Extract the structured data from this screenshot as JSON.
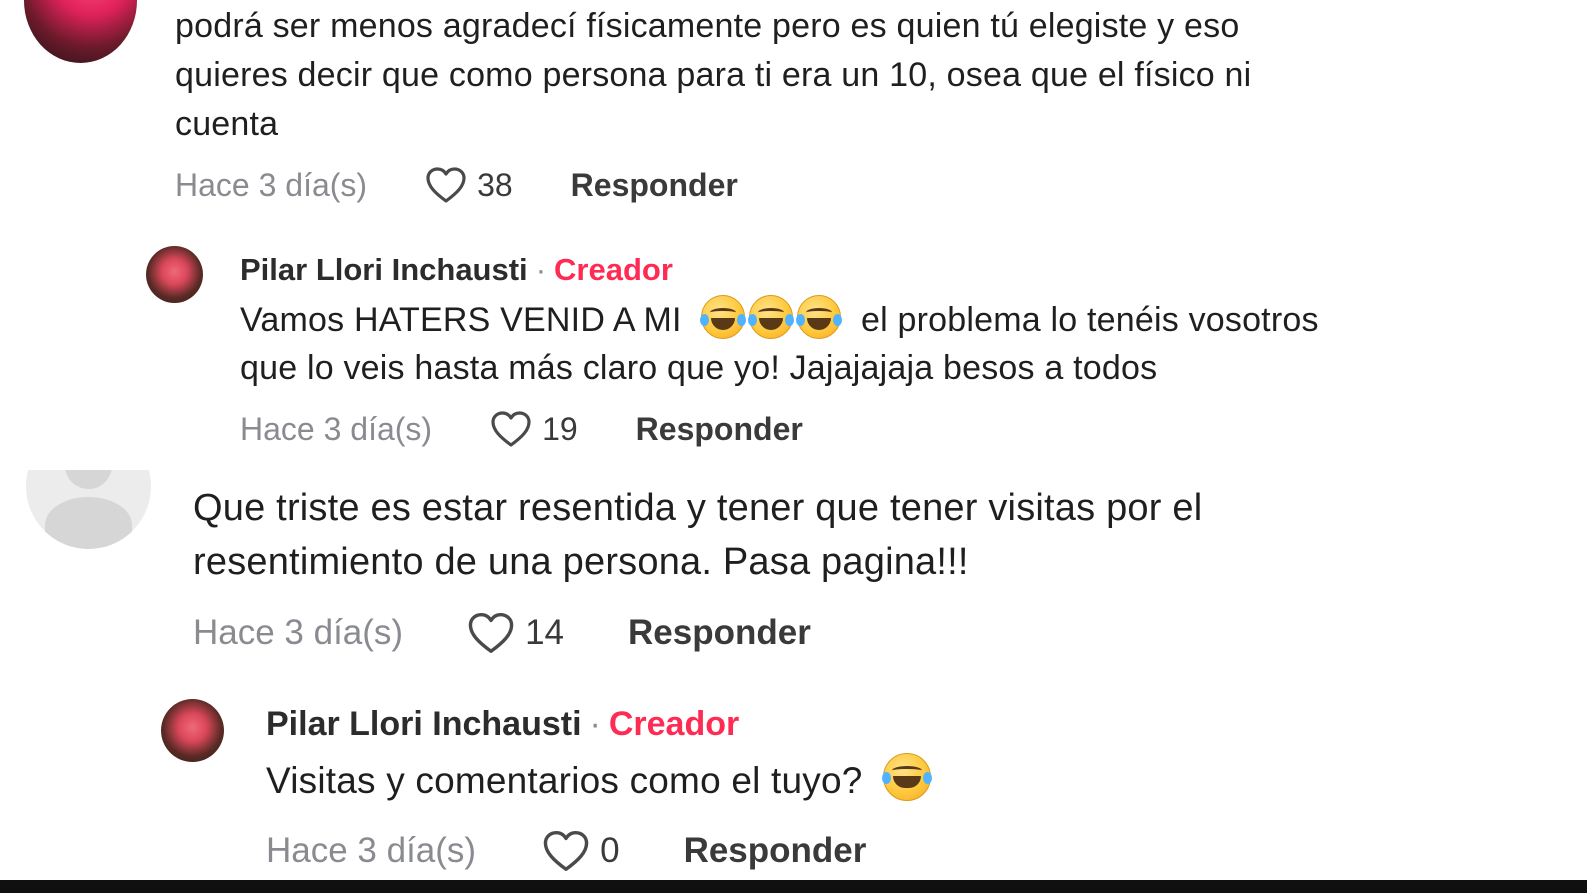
{
  "comments": [
    {
      "text_lines": [
        "podrá ser menos agradecí físicamente pero es quien tú elegiste y eso",
        "quieres decir que como persona para ti era un 10, osea que el físico ni",
        "cuenta"
      ],
      "time": "Hace 3 día(s)",
      "likes": "38",
      "reply_label": "Responder"
    },
    {
      "author": "Pilar Llori Inchausti",
      "separator": "·",
      "badge": "Creador",
      "line1_before": "Vamos HATERS VENID A MI",
      "line1_after": "el problema lo tenéis vosotros",
      "line2": "que lo veis hasta más claro que yo! Jajajajaja besos a todos",
      "emojis": [
        "face-with-tears-of-joy-icon",
        "face-with-tears-of-joy-icon",
        "face-with-tears-of-joy-icon"
      ],
      "time": "Hace 3 día(s)",
      "likes": "19",
      "reply_label": "Responder"
    },
    {
      "text_lines": [
        "Que triste es estar resentida y tener que tener visitas por el",
        "resentimiento de una persona. Pasa pagina!!!"
      ],
      "time": "Hace 3 día(s)",
      "likes": "14",
      "reply_label": "Responder"
    },
    {
      "author": "Pilar Llori Inchausti",
      "separator": "·",
      "badge": "Creador",
      "line1_before": "Visitas y comentarios como el tuyo?",
      "emojis": [
        "face-with-tears-of-joy-icon"
      ],
      "time": "Hace 3 día(s)",
      "likes": "0",
      "reply_label": "Responder"
    }
  ],
  "colors": {
    "creator_badge": "#fe2c55",
    "meta_gray": "#8a8b91",
    "text": "#1f1f1f"
  }
}
